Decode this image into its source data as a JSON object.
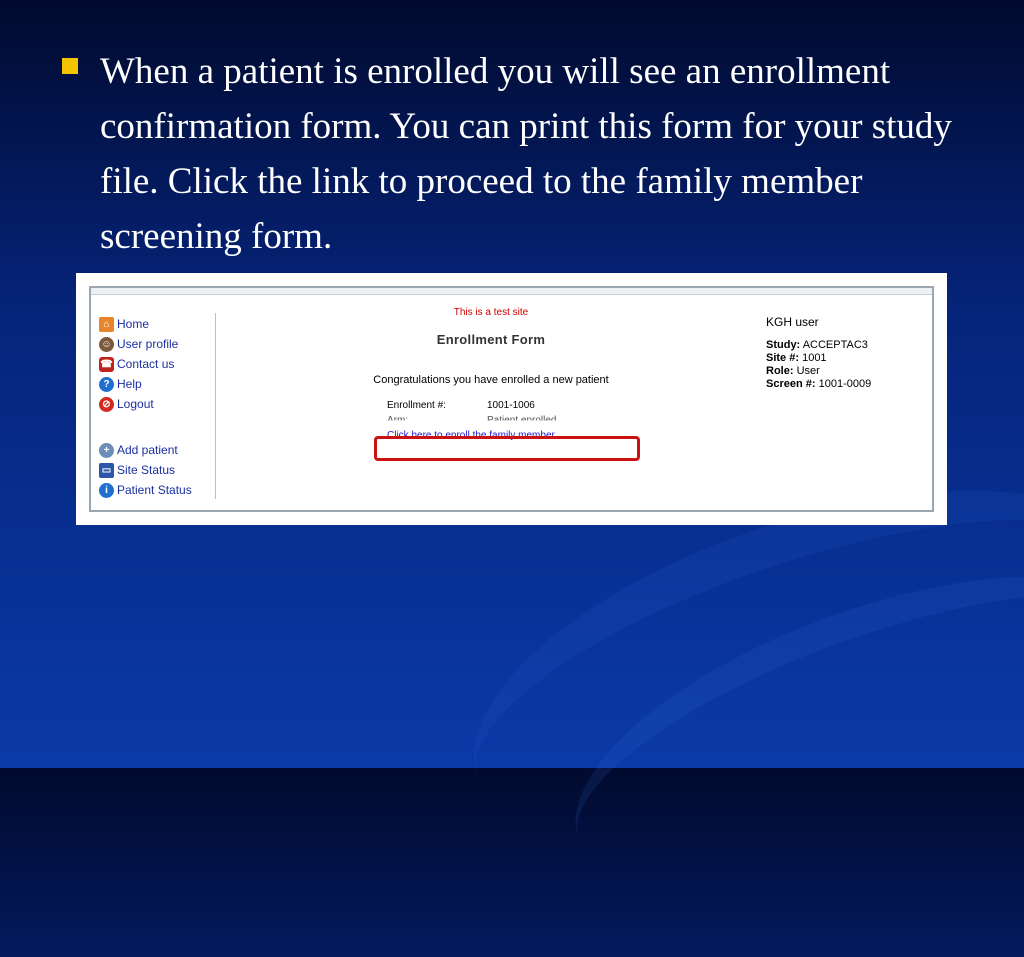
{
  "slide": {
    "bullet_text": "When a patient is enrolled you will see an enrollment confirmation form.  You can print this form for your study file. Click the link to proceed to the family member screening form."
  },
  "colors": {
    "bullet": "#f5c400",
    "background_top": "#010a2e",
    "background_bottom": "#0a3aa8",
    "highlight_box": "#cc1111",
    "link": "#1a1acc",
    "test_site": "#d10000"
  },
  "screenshot": {
    "nav": {
      "items": [
        {
          "label": "Home",
          "icon": "home-icon"
        },
        {
          "label": "User profile",
          "icon": "user-icon"
        },
        {
          "label": "Contact us",
          "icon": "phone-icon"
        },
        {
          "label": "Help",
          "icon": "help-icon"
        },
        {
          "label": "Logout",
          "icon": "logout-icon"
        }
      ],
      "items2": [
        {
          "label": "Add patient",
          "icon": "add-patient-icon"
        },
        {
          "label": "Site Status",
          "icon": "monitor-icon"
        },
        {
          "label": "Patient Status",
          "icon": "info-icon"
        }
      ]
    },
    "test_site": "This is a test site",
    "form_title": "Enrollment Form",
    "congrats": "Congratulations you have enrolled a new patient",
    "enrollment_label": "Enrollment #:",
    "enrollment_value": "1001-1006",
    "arm_label": "Arm:",
    "arm_value": "Patient enrolled",
    "enroll_link": "Click here to enroll the family member",
    "info": {
      "user": "KGH user",
      "study_label": "Study:",
      "study_value": "ACCEPTAC3",
      "site_label": "Site #:",
      "site_value": "1001",
      "role_label": "Role:",
      "role_value": "User",
      "screen_label": "Screen #:",
      "screen_value": "1001-0009"
    }
  }
}
